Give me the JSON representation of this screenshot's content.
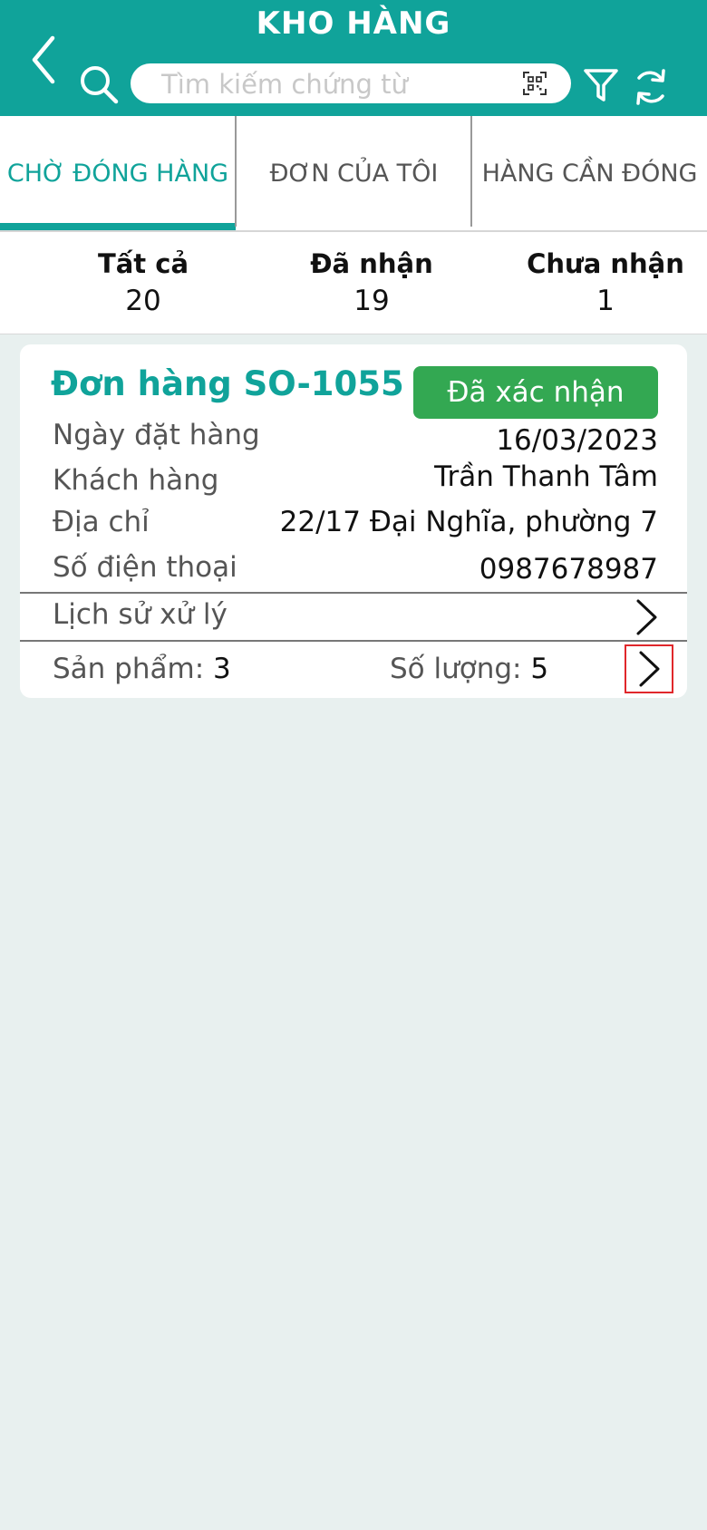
{
  "header": {
    "title": "KHO HÀNG",
    "search_placeholder": "Tìm kiếm chứng từ",
    "accent_color": "#10a39a"
  },
  "tabs": [
    {
      "label": "CHỜ ĐÓNG HÀNG",
      "active": true
    },
    {
      "label": "ĐƠN CỦA TÔI",
      "active": false
    },
    {
      "label": "HÀNG CẦN ĐÓNG",
      "active": false
    }
  ],
  "stats": [
    {
      "label": "Tất cả",
      "value": "20"
    },
    {
      "label": "Đã nhận",
      "value": "19"
    },
    {
      "label": "Chưa nhận",
      "value": "1"
    }
  ],
  "order": {
    "title": "Đơn hàng SO-1055",
    "status": "Đã xác nhận",
    "status_color": "#33a852",
    "fields": [
      {
        "label": "Ngày đặt hàng",
        "value": "16/03/2023"
      },
      {
        "label": "Khách hàng",
        "value": "Trần Thanh Tâm"
      },
      {
        "label": "Địa chỉ",
        "value": "22/17 Đại Nghĩa, phường 7"
      },
      {
        "label": "Số điện thoại",
        "value": "0987678987"
      }
    ],
    "history_label": "Lịch sử xử lý",
    "products_label": "Sản phẩm:",
    "products_value": "3",
    "quantity_label": "Số lượng:",
    "quantity_value": "5"
  }
}
